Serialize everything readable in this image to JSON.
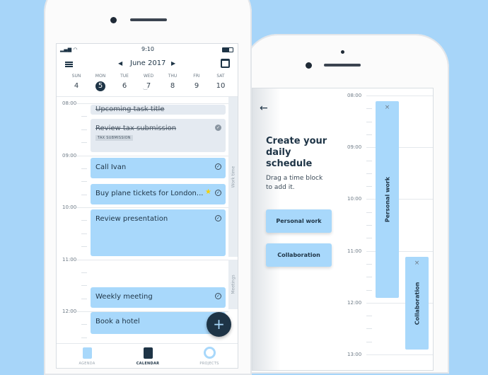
{
  "colors": {
    "background": "#a7d5f9",
    "task": "#a8d8fb",
    "task_done": "#e4eaf1",
    "fab": "#1e3446",
    "star": "#f5d000"
  },
  "phone1": {
    "status": {
      "time": "9:10"
    },
    "header": {
      "month": "June",
      "year": "2017",
      "menu_icon": "hamburger-icon",
      "calendar_icon": "calendar-icon"
    },
    "days": [
      {
        "w": "SUN",
        "n": "4"
      },
      {
        "w": "MON",
        "n": "5",
        "selected": true
      },
      {
        "w": "TUE",
        "n": "6"
      },
      {
        "w": "WED",
        "n": "7"
      },
      {
        "w": "THU",
        "n": "8"
      },
      {
        "w": "FRI",
        "n": "9"
      },
      {
        "w": "SAT",
        "n": "10"
      }
    ],
    "hours": [
      "08:00",
      "09:00",
      "10:00",
      "11:00",
      "12:00"
    ],
    "tasks": [
      {
        "title": "Upcoming task title",
        "done": true
      },
      {
        "title": "Review tax submission",
        "done": true,
        "tag": "TAX SUBMISSION"
      },
      {
        "title": "Call Ivan"
      },
      {
        "title": "Buy plane tickets for London...",
        "starred": true
      },
      {
        "title": "Review presentation"
      },
      {
        "title": "Weekly meeting"
      },
      {
        "title": "Book a hotel"
      }
    ],
    "blocks": [
      "Work time",
      "Meetings"
    ],
    "tabs": [
      {
        "label": "AGENDA"
      },
      {
        "label": "CALENDAR",
        "active": true
      },
      {
        "label": "PROJECTS"
      }
    ]
  },
  "phone2": {
    "title": "Create your daily schedule",
    "subtitle": "Drag a time block to add it.",
    "buttons": [
      "Personal work",
      "Collaboration"
    ],
    "hours": [
      "08:00",
      "09:00",
      "10:00",
      "11:00",
      "12:00",
      "13:00"
    ],
    "blocks": [
      {
        "label": "Personal work",
        "start": "08:05",
        "end": "11:55"
      },
      {
        "label": "Collaboration",
        "start": "11:10",
        "end": "12:55"
      }
    ]
  }
}
